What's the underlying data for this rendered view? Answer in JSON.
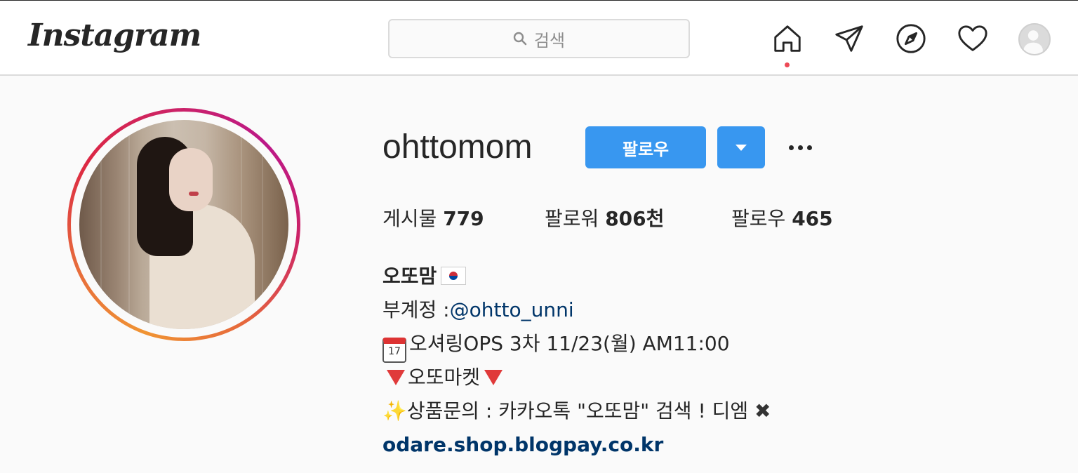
{
  "nav": {
    "logo": "Instagram",
    "search_placeholder": "검색"
  },
  "profile": {
    "username": "ohttomom",
    "follow_label": "팔로우",
    "stats": [
      {
        "label": "게시물",
        "value": "779"
      },
      {
        "label": "팔로워",
        "value": "806천"
      },
      {
        "label": "팔로우",
        "value": "465"
      }
    ],
    "bio": {
      "name": "오또맘",
      "subaccount_prefix": "부계정 :",
      "subaccount_handle": "@ohtto_unni",
      "calendar_day": "17",
      "line3": "오셔링OPS 3차 11/23(월) AM11:00",
      "line4": "오또마켓",
      "line5": "상품문의 : 카카오톡 \"오또맘\" 검색 ! 디엠",
      "cross": "✖",
      "sparkle": "✨",
      "website": "odare.shop.blogpay.co.kr"
    }
  },
  "colors": {
    "accent": "#3897f0",
    "link": "#003569",
    "notification_dot": "#ed4956"
  },
  "icons": [
    "home-icon",
    "direct-icon",
    "explore-icon",
    "activity-heart-icon",
    "profile-avatar-icon",
    "search-icon",
    "chevron-down-icon",
    "more-options-icon"
  ]
}
